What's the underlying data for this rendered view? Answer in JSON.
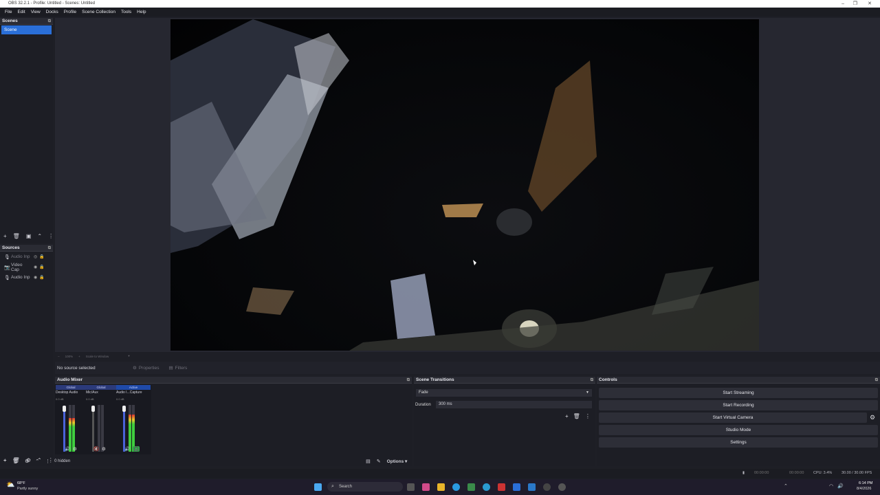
{
  "window": {
    "title": "OBS 32.2.1 - Profile: Untitled - Scenes: Untitled",
    "controls": [
      "–",
      "❐",
      "✕"
    ]
  },
  "menu": [
    "File",
    "Edit",
    "View",
    "Docks",
    "Profile",
    "Scene Collection",
    "Tools",
    "Help"
  ],
  "scenes": {
    "title": "Scenes",
    "items": [
      "Scene"
    ]
  },
  "sources": {
    "title": "Sources",
    "items": [
      "Audio Inp",
      "Video Cap",
      "Audio Inp"
    ]
  },
  "preview": {
    "zoom": "100%",
    "scale_label": "Scale to Window"
  },
  "properties_bar": {
    "no_source": "No source selected",
    "properties": "Properties",
    "filters": "Filters"
  },
  "audio_mixer": {
    "title": "Audio Mixer",
    "channels": [
      {
        "tag": "Global",
        "name": "Desktop Audio",
        "db": "0.0 dB",
        "level": 0.72
      },
      {
        "tag": "Global",
        "name": "Mic/Aux",
        "db": "0.0 dB",
        "level": 0.0
      },
      {
        "tag": "Active",
        "name": "Audio I...Capture",
        "db": "0.0 dB",
        "level": 0.8
      }
    ]
  },
  "scene_transitions": {
    "title": "Scene Transitions",
    "transition": "Fade",
    "duration_label": "Duration",
    "duration_value": "300 ms"
  },
  "controls": {
    "title": "Controls",
    "start_streaming": "Start Streaming",
    "start_recording": "Start Recording",
    "start_virtual_camera": "Start Virtual Camera",
    "studio_mode": "Studio Mode",
    "settings": "Settings"
  },
  "bottom": {
    "hidden": "0 hidden",
    "options": "Options"
  },
  "status": {
    "stream_time": "00:00:00",
    "rec_time": "00:00:00",
    "cpu": "CPU: 3.4%",
    "fps": "30.00 / 30.00 FPS"
  },
  "taskbar": {
    "temp": "68°F",
    "weather": "Partly sunny",
    "search": "Search",
    "time": "6:14 PM",
    "date": "8/4/2026"
  },
  "colors": {
    "accent": "#2a6fd8",
    "bg": "#1d1e25"
  }
}
